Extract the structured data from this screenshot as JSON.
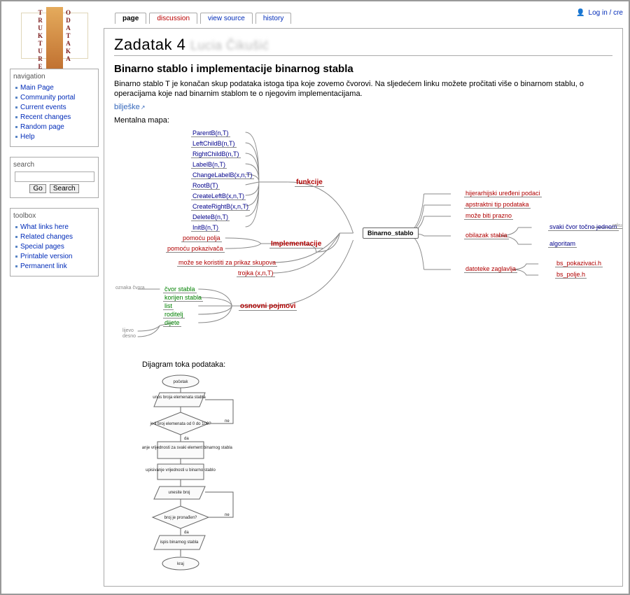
{
  "account": {
    "login": "Log in / cre",
    "icon": "person-icon"
  },
  "tabs": [
    {
      "label": "page",
      "kind": "sel"
    },
    {
      "label": "discussion",
      "kind": "red"
    },
    {
      "label": "view source",
      "kind": "blue"
    },
    {
      "label": "history",
      "kind": "blue"
    }
  ],
  "nav": {
    "title": "navigation",
    "items": [
      "Main Page",
      "Community portal",
      "Current events",
      "Recent changes",
      "Random page",
      "Help"
    ]
  },
  "search": {
    "title": "search",
    "go": "Go",
    "search": "Search",
    "placeholder": ""
  },
  "toolbox": {
    "title": "toolbox",
    "items": [
      "What links here",
      "Related changes",
      "Special pages",
      "Printable version",
      "Permanent link"
    ]
  },
  "page_title": "Zadatak 4",
  "page_title_sub": "Lucia Čikušić",
  "h2": "Binarno stablo i implementacije binarnog stabla",
  "intro": "Binarno stablo T je konačan skup podataka istoga tipa koje zovemo čvorovi. Na sljedećem linku možete pročitati više o binarnom stablu, o operacijama koje nad binarnim stablom te o njegovim implementacijama.",
  "notes_link": "bilješke",
  "mm_label": "Mentalna mapa:",
  "flow_label": "Dijagram toka podataka:",
  "mindmap": {
    "center": "Binarno_stablo",
    "left": {
      "funkcije": {
        "label": "funkcije",
        "items": [
          "ParentB(n,T)",
          "LeftChildB(n,T)",
          "RightChildB(n,T)",
          "LabelB(n,T)",
          "ChangeLabelB(x,n,T)",
          "RootB(T)",
          "CreateLeftB(x,n,T)",
          "CreateRightB(x,n,T)",
          "DeleteB(n,T)",
          "InitB(n,T)"
        ]
      },
      "implementacije": {
        "label": "Implementacije",
        "items": [
          "pomoću polja",
          "pomoću pokazivača"
        ],
        "extra": [
          "može se koristiti za prikaz skupova",
          "trojka (x,n,T)"
        ]
      },
      "osnovni": {
        "label": "osnovni pojmovi",
        "items": [
          "čvor stabla",
          "korijen stabla",
          "list",
          "roditelj",
          "dijete"
        ],
        "sub": {
          "parent": "oznaka čvora",
          "children": [
            "lijevo",
            "desno"
          ]
        }
      }
    },
    "right": {
      "plain": [
        "hijerarhijski uređeni podaci",
        "apstraktni tip podataka",
        "može biti prazno"
      ],
      "obilazak": {
        "label": "obilazak stabla",
        "items": [
          "svaki čvor točno jednom",
          "algoritam"
        ],
        "tail": "rekurzivno zadavanje"
      },
      "datoteke": {
        "label": "datoteke zaglavlja",
        "items": [
          "bs_pokazivaci.h",
          "bs_polje.h"
        ]
      }
    }
  },
  "flowchart": {
    "nodes": [
      "početak",
      "unos broja elemenata stabla",
      "je li broj elemenata od 0 do 100?",
      "generiranje vrijednosti za svaki element binarnog stabla",
      "upisivanje vrijednosti u binarno stablo",
      "unesite broj",
      "broj je pronađen?",
      "ispis binarnog stabla",
      "kraj"
    ],
    "branches": {
      "yes": "da",
      "no": "ne"
    }
  }
}
